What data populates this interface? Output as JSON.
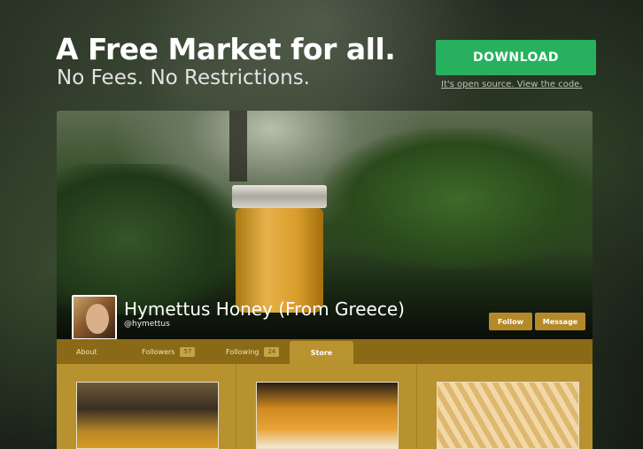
{
  "hero": {
    "title": "A Free Market for all.",
    "subtitle": "No Fees. No Restrictions.",
    "download_label": "DOWNLOAD",
    "open_source_link": "It's open source. View the code."
  },
  "store": {
    "name": "Hymettus Honey (From Greece)",
    "handle": "@hymettus",
    "follow_label": "Follow",
    "message_label": "Message",
    "tabs": [
      {
        "label": "About"
      },
      {
        "label": "Followers",
        "count": "57"
      },
      {
        "label": "Following",
        "count": "24"
      },
      {
        "label": "Store"
      }
    ],
    "active_tab": "Store"
  },
  "colors": {
    "download_green": "#27b15e",
    "store_gold": "#b99330",
    "store_dark_gold": "#8b6a17"
  },
  "icons": [
    "avatar-image",
    "honey-jar-image",
    "product-image"
  ]
}
